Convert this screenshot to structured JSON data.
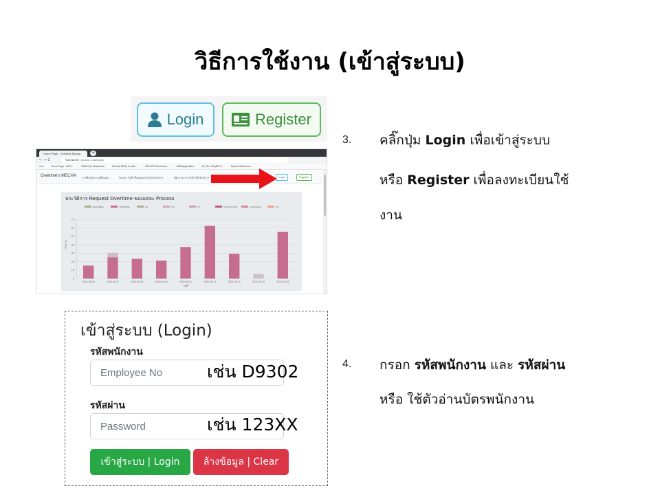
{
  "title": "วิธีการใช้งาน (เข้าสู่ระบบ)",
  "zoom_buttons": {
    "login": "Login",
    "register": "Register"
  },
  "browser": {
    "tab_title": "Home Page - Overtime Mecha",
    "url": "ไม่ปลอดภัย | 10.121.1.122:1101",
    "bookmarks": [
      "แอป",
      "Home Page - MEC...",
      "YAMA LQI Dashboard",
      "Shoelat IBES) คาคติบ...",
      "SEC APS Developm...",
      "SWMApplication",
      "10.121.1.88 (BE-S...",
      "Python Webserver..."
    ],
    "brand": "Overtime's MECHA",
    "nav": [
      "รายชื่อพนักงานทั้งหมด",
      "ร้องขอ โอที (Request Overtime) ▾",
      "เพิ่มรายการ (Add Details) ▾"
    ],
    "login": "Login",
    "register": "Register"
  },
  "chart_data": {
    "type": "bar",
    "title": "ประวัติการ Request Overtime ของแต่ละ Process",
    "legend": [
      "ENGINEER",
      "JAPANESE",
      "MC",
      "MH",
      "PC",
      "PRODUCTION",
      "PURCHASE",
      "QC"
    ],
    "legend_colors": [
      "#a8b37e",
      "#c86b93",
      "#b4a88e",
      "#d6a7b8",
      "#c9a0c0",
      "#c0587f",
      "#d98a9a",
      "#f1a08b"
    ],
    "categories": [
      "2020-06-16",
      "2020-06-17",
      "2020-06-18",
      "2020-06-19",
      "2020-06-21",
      "2020-06-22",
      "2020-06-23",
      "2020-06-24",
      "2020-10-03"
    ],
    "series": [
      {
        "name": "PRODUCTION",
        "values": [
          15,
          25,
          23,
          21,
          37,
          62,
          29,
          0,
          55
        ]
      },
      {
        "name": "MH",
        "values": [
          0,
          5,
          0,
          0,
          0,
          0,
          0,
          5,
          0
        ]
      }
    ],
    "ylim": [
      0,
      70
    ],
    "yticks": [
      0,
      10,
      20,
      30,
      40,
      50,
      60,
      70
    ],
    "ylabel": "จำนวน",
    "xlabel": "วันที่"
  },
  "login_form": {
    "heading": "เข้าสู่ระบบ (Login)",
    "employee_label": "รหัสพนักงาน",
    "employee_placeholder": "Employee No",
    "employee_example": "เช่น D9302",
    "password_label": "รหัสผ่าน",
    "password_placeholder": "Password",
    "password_example": "เช่น 123XX",
    "submit": "เข้าสู่ระบบ | Login",
    "clear": "ล้างข้อมูล | Clear"
  },
  "step3": {
    "number": "3.",
    "prefix": "คลิ๊กปุ่ม",
    "login": "Login",
    "middle": "เพื่อเข้าสู่ระบบ",
    "or": "หรือ",
    "register": "Register",
    "suffix": "เพื่อลงทะเบียนใช้",
    "wrap": "งาน"
  },
  "step4": {
    "number": "4.",
    "prefix": "กรอก",
    "employee": "รหัสพนักงาน",
    "and": "และ",
    "password": "รหัสผ่าน",
    "line2": "หรือ ใช้ตัวอ่านบัตรพนักงาน"
  }
}
